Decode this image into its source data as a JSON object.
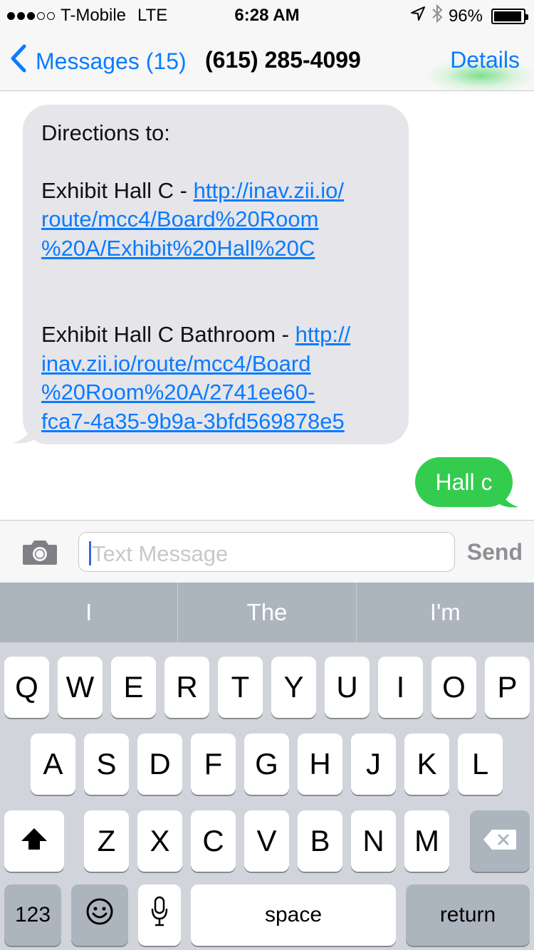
{
  "status_bar": {
    "carrier": "T-Mobile",
    "network": "LTE",
    "time": "6:28 AM",
    "battery": "96%",
    "battery_level": 0.96
  },
  "nav": {
    "back_label": "Messages (15)",
    "title": "(615) 285-4099",
    "details_label": "Details"
  },
  "messages": {
    "incoming": {
      "line1": "Directions to:",
      "item1_prefix": "Exhibit Hall C - ",
      "item1_link": "http://inav.zii.io/route/mcc4/Board%20Room%20A/Exhibit%20Hall%20C",
      "item2_prefix": "Exhibit Hall C Bathroom - ",
      "item2_link": "http://inav.zii.io/route/mcc4/Board%20Room%20A/2741ee60-fca7-4a35-9b9a-3bfd569878e5"
    },
    "outgoing": {
      "text": "Hall c"
    }
  },
  "input": {
    "placeholder": "Text Message",
    "send_label": "Send"
  },
  "suggestions": [
    "I",
    "The",
    "I'm"
  ],
  "keyboard": {
    "row1": [
      "Q",
      "W",
      "E",
      "R",
      "T",
      "Y",
      "U",
      "I",
      "O",
      "P"
    ],
    "row2": [
      "A",
      "S",
      "D",
      "F",
      "G",
      "H",
      "J",
      "K",
      "L"
    ],
    "row3": [
      "Z",
      "X",
      "C",
      "V",
      "B",
      "N",
      "M"
    ],
    "numbers_label": "123",
    "space_label": "space",
    "return_label": "return"
  },
  "icons": {
    "back": "chevron-left-icon",
    "camera": "camera-icon",
    "location": "location-arrow-icon",
    "bluetooth": "bluetooth-icon",
    "shift": "shift-icon",
    "delete": "delete-icon",
    "emoji": "emoji-icon",
    "mic": "microphone-icon"
  },
  "colors": {
    "ios_blue": "#0a7bff",
    "imessage_green": "#33cc4f",
    "bubble_gray": "#e5e5ea"
  }
}
